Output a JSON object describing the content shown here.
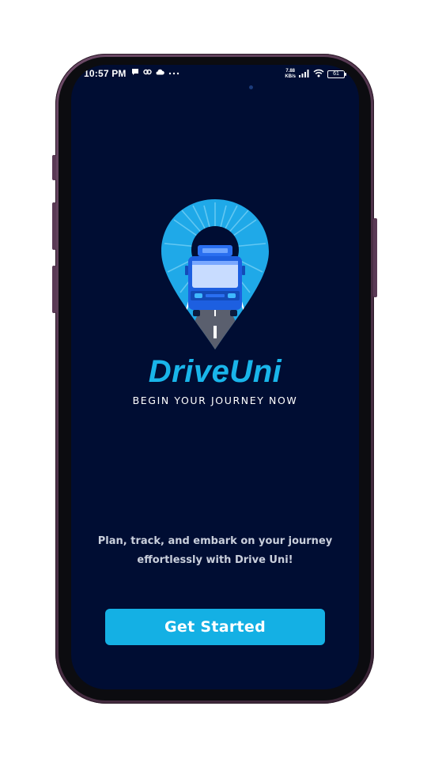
{
  "status_bar": {
    "time": "10:57 PM",
    "net_speed": "7.88",
    "net_unit": "KB/s",
    "battery": "61"
  },
  "brand": {
    "name": "DriveUni",
    "tagline": "BEGIN YOUR JOURNEY NOW"
  },
  "description": {
    "line1": "Plan, track, and embark on your journey",
    "line2": "effortlessly with Drive Uni!"
  },
  "cta": {
    "label": "Get Started"
  },
  "colors": {
    "background": "#000d33",
    "accent": "#14b0e4",
    "phone_frame": "#5a3a55"
  },
  "icons": [
    "chat-icon",
    "link-icon",
    "cloud-icon",
    "more-icon",
    "signal-icon",
    "wifi-icon",
    "battery-icon",
    "bus-location-logo"
  ]
}
